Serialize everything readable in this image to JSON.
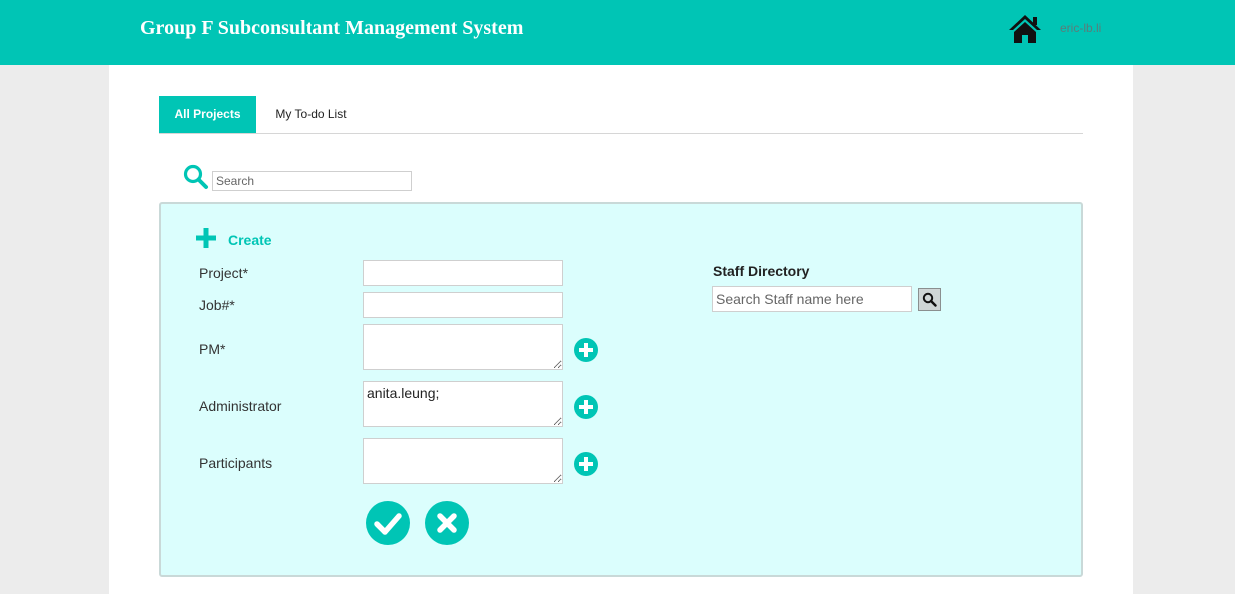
{
  "header": {
    "title": "Group F Subconsultant Management System",
    "user": "eric-lb.li",
    "home_icon": "home-icon"
  },
  "tabs": [
    {
      "label": "All Projects",
      "active": true
    },
    {
      "label": "My To-do List",
      "active": false
    }
  ],
  "search": {
    "placeholder": "Search",
    "icon": "search-icon"
  },
  "create_form": {
    "title": "Create",
    "fields": {
      "project": {
        "label": "Project*",
        "value": ""
      },
      "job": {
        "label": "Job#*",
        "value": ""
      },
      "pm": {
        "label": "PM*",
        "value": ""
      },
      "administrator": {
        "label": "Administrator",
        "value": "anita.leung;"
      },
      "participants": {
        "label": "Participants",
        "value": ""
      }
    },
    "confirm_icon": "check-circle-icon",
    "cancel_icon": "times-circle-icon"
  },
  "staff_directory": {
    "title": "Staff Directory",
    "placeholder": "Search Staff name here"
  },
  "colors": {
    "brand": "#00c5b5",
    "panel_bg": "#dbfefd",
    "page_bg": "#ececec"
  }
}
